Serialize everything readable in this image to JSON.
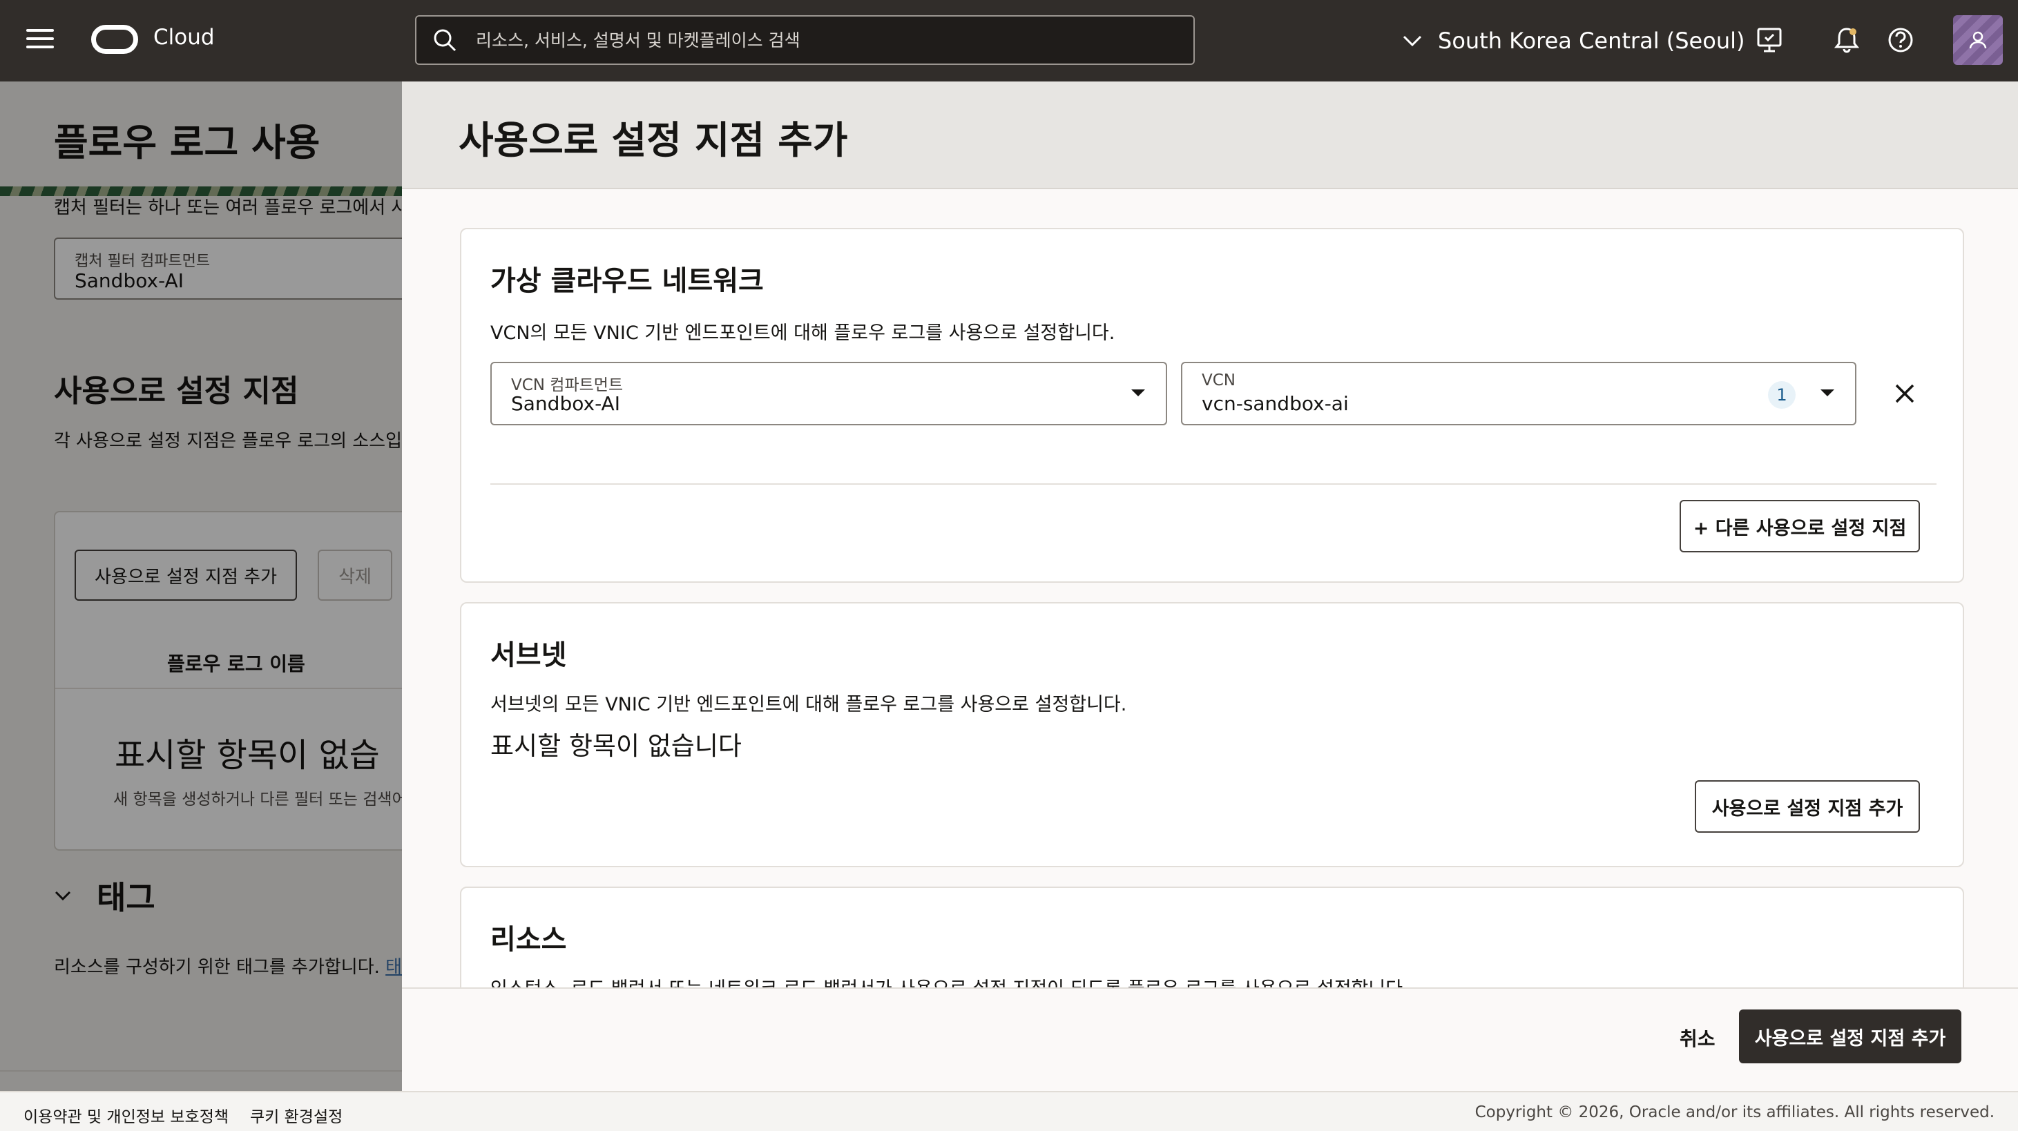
{
  "header": {
    "brand": "Cloud",
    "search_placeholder": "리소스, 서비스, 설명서 및 마켓플레이스 검색",
    "region": "South Korea Central (Seoul)"
  },
  "background_page": {
    "title": "플로우 로그 사용",
    "capture_filter_desc": "캡처 필터는 하나 또는 여러 플로우 로그에서 사",
    "capture_compartment_label": "캡처 필터 컴파트먼트",
    "capture_compartment_value": "Sandbox-AI",
    "enablement_title": "사용으로 설정 지점",
    "enablement_desc": "각 사용으로 설정 지점은 플로우 로그의 소스입",
    "add_button": "사용으로 설정 지점 추가",
    "delete_button": "삭제",
    "column_flow_log_name": "플로우 로그 이름",
    "empty_title": "표시할 항목이 없습",
    "empty_desc": "새 항목을 생성하거나 다른 필터 또는 검색어를",
    "tags_title": "태그",
    "tags_desc": "리소스를 구성하기 위한 태그를 추가합니다.",
    "tags_link": "태"
  },
  "drawer": {
    "title": "사용으로 설정 지점 추가",
    "vcn_section": {
      "title": "가상 클라우드 네트워크",
      "desc": "VCN의 모든 VNIC 기반 엔드포인트에 대해 플로우 로그를 사용으로 설정합니다.",
      "compartment_label": "VCN 컴파트먼트",
      "compartment_value": "Sandbox-AI",
      "vcn_label": "VCN",
      "vcn_value": "vcn-sandbox-ai",
      "vcn_count": "1",
      "add_another": "+ 다른 사용으로 설정 지점"
    },
    "subnet_section": {
      "title": "서브넷",
      "desc": "서브넷의 모든 VNIC 기반 엔드포인트에 대해 플로우 로그를 사용으로 설정합니다.",
      "empty": "표시할 항목이 없습니다",
      "add_button": "사용으로 설정 지점 추가"
    },
    "resource_section": {
      "title": "리소스",
      "desc": "인스턴스, 로드 밸런서 또는 네트워크 로드 밸런서가 사용으로 설정 지점이 되도록 플로우 로그를 사용으로 설정합니다."
    },
    "cancel": "취소",
    "submit": "사용으로 설정 지점 추가"
  },
  "footer": {
    "terms": "이용약관 및 개인정보 보호정책",
    "cookies": "쿠키 환경설정",
    "copyright": "Copyright © 2026, Oracle and/or its affiliates. All rights reserved."
  },
  "colors": {
    "header_bg": "#312d2a",
    "primary_button": "#312d2a",
    "drawer_header_bg": "#e7e5e2"
  },
  "icons": {
    "menu": "hamburger-icon",
    "search": "search-icon",
    "region": "chevron-down-icon",
    "console": "monitor-icon",
    "notifications": "bell-icon",
    "help": "help-icon",
    "profile": "user-icon",
    "remove": "close-icon"
  }
}
